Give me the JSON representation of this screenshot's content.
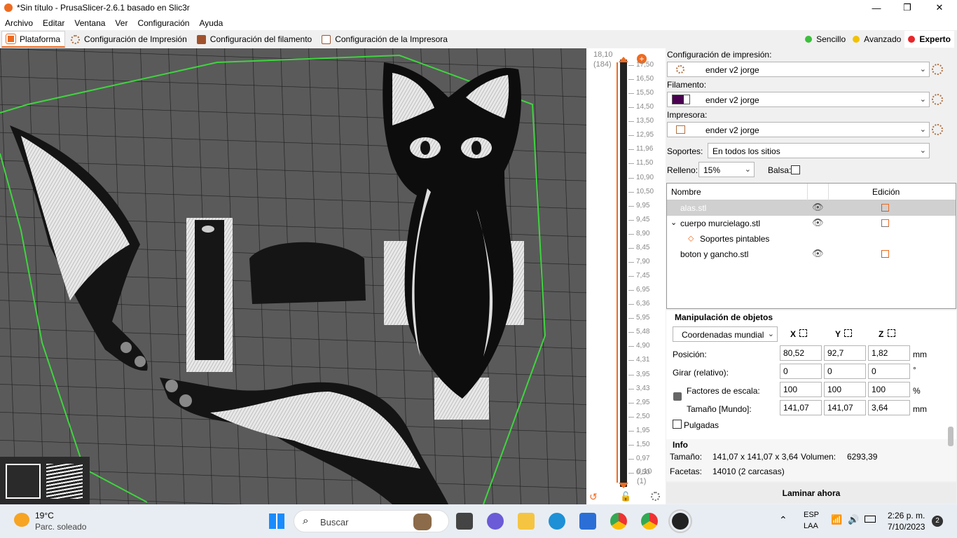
{
  "window": {
    "title": "*Sin título - PrusaSlicer-2.6.1 basado en Slic3r",
    "min": "—",
    "max": "❐",
    "close": "✕"
  },
  "menu": [
    "Archivo",
    "Editar",
    "Ventana",
    "Ver",
    "Configuración",
    "Ayuda"
  ],
  "tabs": [
    {
      "label": "Plataforma",
      "active": true
    },
    {
      "label": "Configuración de Impresión"
    },
    {
      "label": "Configuración del filamento"
    },
    {
      "label": "Configuración de la Impresora"
    }
  ],
  "modes": [
    {
      "label": "Sencillo",
      "color": "#3cbf3c"
    },
    {
      "label": "Avanzado",
      "color": "#f2c200"
    },
    {
      "label": "Experto",
      "color": "#e8262a"
    }
  ],
  "layer_slider": {
    "top_value": "18,10",
    "top_layer": "(184)",
    "bottom_value": "0,10",
    "bottom_layer": "(1)",
    "ticks": [
      "17,50",
      "16,50",
      "15,50",
      "14,50",
      "13,50",
      "12,95",
      "11,96",
      "11,50",
      "10,90",
      "10,50",
      "9,95",
      "9,45",
      "8,90",
      "8,45",
      "7,90",
      "7,45",
      "6,95",
      "6,36",
      "5,95",
      "5,48",
      "4,90",
      "4,31",
      "3,95",
      "3,43",
      "2,95",
      "2,50",
      "1,95",
      "1,50",
      "0,97",
      "0,50",
      "0,10"
    ]
  },
  "sidebar": {
    "print_settings_label": "Configuración de impresión:",
    "print_settings_value": "ender v2 jorge",
    "filament_label": "Filamento:",
    "filament_value": "ender v2 jorge",
    "filament_color": "#4a0050",
    "printer_label": "Impresora:",
    "printer_value": "ender v2 jorge",
    "supports_label": "Soportes:",
    "supports_value": "En todos los sitios",
    "infill_label": "Relleno:",
    "infill_value": "15%",
    "brim_label": "Balsa:"
  },
  "object_list": {
    "col_name": "Nombre",
    "col_edit": "Edición",
    "items": [
      {
        "name": "alas.stl",
        "selected": true
      },
      {
        "name": "cuerpo murcielago.stl",
        "expanded": true
      },
      {
        "name": "Soportes pintables",
        "child": true
      },
      {
        "name": "boton y gancho.stl"
      }
    ]
  },
  "manipulation": {
    "title": "Manipulación de objetos",
    "coord_system": "Coordenadas mundial",
    "axes": [
      "X",
      "Y",
      "Z"
    ],
    "position_label": "Posición:",
    "position": [
      "80,52",
      "92,7",
      "1,82"
    ],
    "position_unit": "mm",
    "rotate_label": "Girar (relativo):",
    "rotate": [
      "0",
      "0",
      "0"
    ],
    "rotate_unit": "°",
    "scale_label": "Factores de escala:",
    "scale": [
      "100",
      "100",
      "100"
    ],
    "scale_unit": "%",
    "size_label": "Tamaño [Mundo]:",
    "size": [
      "141,07",
      "141,07",
      "3,64"
    ],
    "size_unit": "mm",
    "inches_label": "Pulgadas"
  },
  "info": {
    "title": "Info",
    "size_label": "Tamaño:",
    "size_value": "141,07 x 141,07 x 3,64",
    "volume_label": "Volumen:",
    "volume_value": "6293,39",
    "facets_label": "Facetas:",
    "facets_value": "14010 (2 carcasas)"
  },
  "slice_button": "Laminar ahora",
  "taskbar": {
    "weather_temp": "19°C",
    "weather_desc": "Parc. soleado",
    "search": "Buscar",
    "lang1": "ESP",
    "lang2": "LAA",
    "time": "2:26 p. m.",
    "date": "7/10/2023",
    "notif": "2"
  }
}
